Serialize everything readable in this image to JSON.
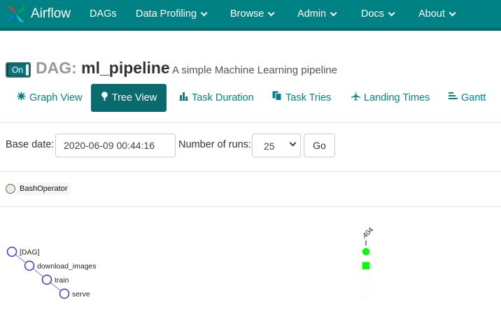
{
  "navbar": {
    "brand": "Airflow",
    "items": [
      {
        "label": "DAGs",
        "dropdown": false
      },
      {
        "label": "Data Profiling",
        "dropdown": true
      },
      {
        "label": "Browse",
        "dropdown": true
      },
      {
        "label": "Admin",
        "dropdown": true
      },
      {
        "label": "Docs",
        "dropdown": true
      },
      {
        "label": "About",
        "dropdown": true
      }
    ],
    "color": "#008285"
  },
  "dag": {
    "toggle_label": "On",
    "title_prefix": "DAG:",
    "dag_id": "ml_pipeline",
    "description": "A simple Machine Learning pipeline"
  },
  "tabs": [
    {
      "label": "Graph View",
      "icon": "graph-icon",
      "active": false
    },
    {
      "label": "Tree View",
      "icon": "tree-icon",
      "active": true
    },
    {
      "label": "Task Duration",
      "icon": "bar-chart-icon",
      "active": false
    },
    {
      "label": "Task Tries",
      "icon": "duplicate-icon",
      "active": false
    },
    {
      "label": "Landing Times",
      "icon": "plane-icon",
      "active": false
    },
    {
      "label": "Gantt",
      "icon": "gantt-icon",
      "active": false
    }
  ],
  "form": {
    "base_date_label": "Base date:",
    "base_date_value": "2020-06-09 00:44:16",
    "num_runs_label": "Number of runs:",
    "num_runs_value": "25",
    "go_label": "Go"
  },
  "legend": {
    "operators": [
      {
        "label": "BashOperator",
        "color": "#f0ede4"
      }
    ]
  },
  "tree": {
    "run_label": ".404",
    "nodes": [
      {
        "label": "[DAG]",
        "depth": 0,
        "status": "success",
        "status_color": "#00ff00",
        "shape": "circle"
      },
      {
        "label": "download_images",
        "depth": 1,
        "status": "success",
        "status_color": "#00ff00",
        "shape": "square"
      },
      {
        "label": "train",
        "depth": 2,
        "status": "no_status",
        "status_color": "#ffffff",
        "shape": "square"
      },
      {
        "label": "serve",
        "depth": 3,
        "status": "no_status",
        "status_color": "#ffffff",
        "shape": "square"
      }
    ],
    "node_stroke": "#4b2ee8",
    "link_color": "#9ab5d1"
  }
}
